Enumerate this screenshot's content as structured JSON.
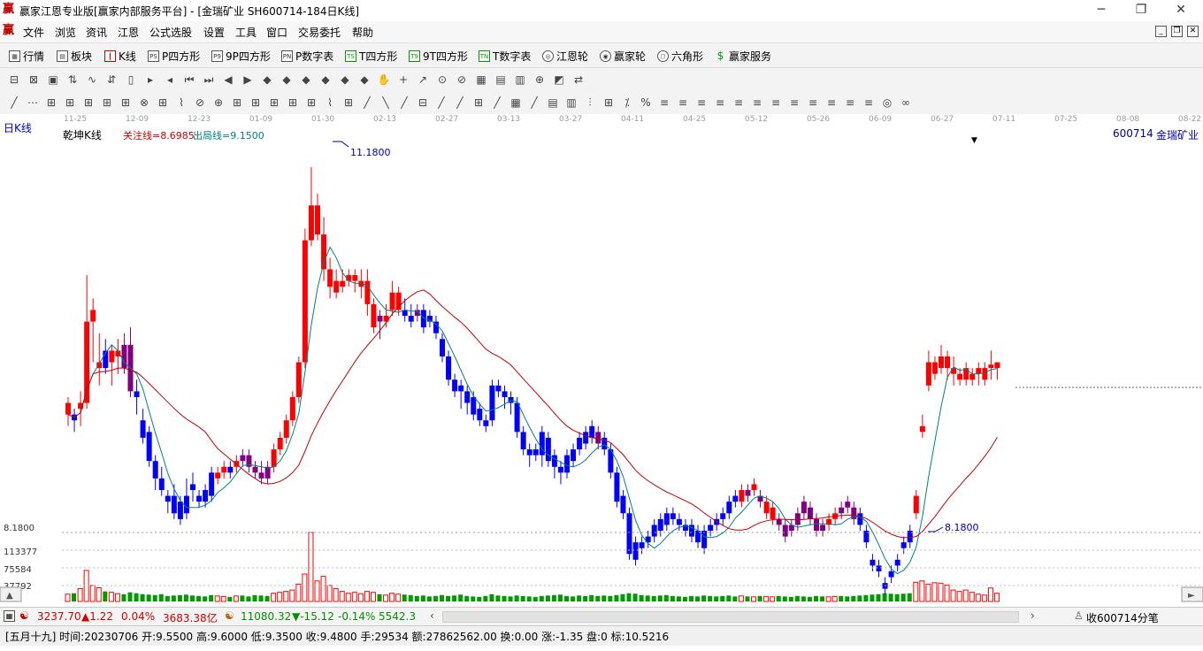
{
  "window": {
    "title": "赢家江恩专业版[赢家内部服务平台] - [金瑞矿业  SH600714-184日K线]",
    "app_icon": "赢",
    "controls": [
      "minimize-icon",
      "restore-icon",
      "close-icon"
    ]
  },
  "menu": {
    "items": [
      "文件",
      "浏览",
      "资讯",
      "江恩",
      "公式选股",
      "设置",
      "工具",
      "窗口",
      "交易委托",
      "帮助"
    ]
  },
  "toolbar": {
    "items": [
      {
        "icon": "grid-icon",
        "label": "行情"
      },
      {
        "icon": "blocks-icon",
        "label": "板块"
      },
      {
        "icon": "candles-icon",
        "label": "K线"
      },
      {
        "icon": "ps-icon",
        "label": "P四方形"
      },
      {
        "icon": "p9-icon",
        "label": "9P四方形"
      },
      {
        "icon": "pn-icon",
        "label": "P数字表"
      },
      {
        "icon": "ts-icon",
        "label": "T四方形"
      },
      {
        "icon": "t9-icon",
        "label": "9T四方形"
      },
      {
        "icon": "tn-icon",
        "label": "T数字表"
      },
      {
        "icon": "gann-wheel-icon",
        "label": "江恩轮"
      },
      {
        "icon": "winner-wheel-icon",
        "label": "赢家轮"
      },
      {
        "icon": "hexagon-icon",
        "label": "六角形"
      },
      {
        "icon": "dollar-icon",
        "label": "赢家服务"
      }
    ]
  },
  "chart_header": {
    "period_label": "日K线",
    "chart_name": "乾坤K线",
    "focus_line": "关注线=8.6985",
    "exit_line": "出局线=9.1500",
    "symbol": "600714",
    "stock_name": "金瑞矿业"
  },
  "date_axis": [
    "11-25",
    "12-09",
    "12-23",
    "01-09",
    "01-30",
    "02-13",
    "02-27",
    "03-13",
    "03-27",
    "04-11",
    "04-25",
    "05-12",
    "05-26",
    "06-09",
    "06-27",
    "07-11",
    "07-25",
    "08-08",
    "08-22"
  ],
  "price_axis": {
    "low_label": "8.1800"
  },
  "volume_axis": [
    "113377",
    "75584",
    "37792"
  ],
  "annotations": {
    "high": "11.1800",
    "low": "8.1800"
  },
  "colors": {
    "up": "#ff0000",
    "down": "#0000ff",
    "neutral": "#800080",
    "ma_short": "#008080",
    "ma_long": "#c00000",
    "volume_up": "#ff0000",
    "volume_down": "#009900"
  },
  "chart_data": {
    "type": "candlestick",
    "price_range": [
      8.05,
      11.4
    ],
    "volume_range": [
      0,
      151000
    ],
    "candles": [
      [
        9.15,
        9.05,
        9.2,
        8.95,
        "up",
        16000
      ],
      [
        9.05,
        9.0,
        9.1,
        8.9,
        "down",
        18000
      ],
      [
        9.1,
        9.15,
        9.25,
        8.95,
        "up",
        28000
      ],
      [
        9.15,
        9.85,
        10.25,
        9.1,
        "up",
        68000
      ],
      [
        9.85,
        9.95,
        10.05,
        9.5,
        "up",
        35000
      ],
      [
        9.45,
        9.5,
        9.75,
        9.3,
        "up",
        30000
      ],
      [
        9.6,
        9.45,
        9.7,
        9.4,
        "down",
        22000
      ],
      [
        9.6,
        9.5,
        9.65,
        9.3,
        "up",
        20000
      ],
      [
        9.55,
        9.6,
        9.7,
        9.4,
        "up",
        17000
      ],
      [
        9.65,
        9.45,
        9.75,
        9.4,
        "neutral",
        16000
      ],
      [
        9.65,
        9.25,
        9.8,
        9.2,
        "neutral",
        20000
      ],
      [
        9.25,
        9.2,
        9.35,
        9.05,
        "down",
        18000
      ],
      [
        9.0,
        8.85,
        9.1,
        8.8,
        "down",
        16000
      ],
      [
        8.9,
        8.65,
        8.95,
        8.6,
        "down",
        15000
      ],
      [
        8.65,
        8.5,
        8.7,
        8.4,
        "down",
        14000
      ],
      [
        8.5,
        8.4,
        8.6,
        8.35,
        "down",
        16000
      ],
      [
        8.35,
        8.3,
        8.4,
        8.2,
        "down",
        12000
      ],
      [
        8.35,
        8.2,
        8.45,
        8.15,
        "down",
        13000
      ],
      [
        8.3,
        8.15,
        8.35,
        8.1,
        "down",
        14000
      ],
      [
        8.35,
        8.2,
        8.5,
        8.15,
        "down",
        15000
      ],
      [
        8.45,
        8.4,
        8.55,
        8.3,
        "down",
        13000
      ],
      [
        8.35,
        8.3,
        8.4,
        8.25,
        "down",
        12000
      ],
      [
        8.4,
        8.3,
        8.45,
        8.25,
        "down",
        11000
      ],
      [
        8.55,
        8.35,
        8.6,
        8.3,
        "down",
        14000
      ],
      [
        8.5,
        8.55,
        8.6,
        8.45,
        "up",
        12000
      ],
      [
        8.55,
        8.6,
        8.65,
        8.5,
        "up",
        11000
      ],
      [
        8.6,
        8.55,
        8.65,
        8.5,
        "down",
        10000
      ],
      [
        8.6,
        8.65,
        8.7,
        8.55,
        "up",
        12000
      ],
      [
        8.65,
        8.7,
        8.75,
        8.6,
        "neutral",
        13000
      ],
      [
        8.7,
        8.6,
        8.75,
        8.55,
        "neutral",
        11000
      ],
      [
        8.6,
        8.55,
        8.65,
        8.5,
        "neutral",
        14000
      ],
      [
        8.55,
        8.5,
        8.65,
        8.45,
        "neutral",
        13000
      ],
      [
        8.5,
        8.6,
        8.65,
        8.45,
        "neutral",
        12000
      ],
      [
        8.6,
        8.75,
        8.8,
        8.55,
        "up",
        18000
      ],
      [
        8.75,
        8.85,
        8.9,
        8.7,
        "up",
        20000
      ],
      [
        8.85,
        9.0,
        9.05,
        8.8,
        "up",
        22000
      ],
      [
        9.0,
        9.2,
        9.25,
        8.95,
        "up",
        25000
      ],
      [
        9.2,
        9.5,
        9.55,
        9.15,
        "up",
        38000
      ],
      [
        9.5,
        10.55,
        10.65,
        9.45,
        "up",
        60000
      ],
      [
        10.55,
        10.85,
        11.18,
        10.5,
        "up",
        151000
      ],
      [
        10.85,
        10.6,
        10.95,
        10.55,
        "up",
        45000
      ],
      [
        10.6,
        10.3,
        10.75,
        10.2,
        "up",
        55000
      ],
      [
        10.3,
        10.15,
        10.4,
        10.05,
        "up",
        35000
      ],
      [
        10.2,
        10.1,
        10.3,
        10.05,
        "up",
        28000
      ],
      [
        10.15,
        10.2,
        10.3,
        10.1,
        "up",
        22000
      ],
      [
        10.2,
        10.25,
        10.3,
        10.15,
        "up",
        18000
      ],
      [
        10.25,
        10.2,
        10.3,
        10.1,
        "up",
        20000
      ],
      [
        10.2,
        10.15,
        10.3,
        10.05,
        "up",
        17000
      ],
      [
        10.2,
        10.0,
        10.3,
        9.9,
        "up",
        22000
      ],
      [
        10.0,
        9.8,
        10.05,
        9.75,
        "up",
        20000
      ],
      [
        9.85,
        9.9,
        9.95,
        9.7,
        "neutral",
        16000
      ],
      [
        9.85,
        9.9,
        10.0,
        9.8,
        "up",
        14000
      ],
      [
        9.95,
        10.1,
        10.2,
        9.9,
        "up",
        18000
      ],
      [
        10.1,
        9.95,
        10.15,
        9.9,
        "up",
        16000
      ],
      [
        9.95,
        9.9,
        10.05,
        9.85,
        "down",
        15000
      ],
      [
        9.9,
        9.85,
        10.0,
        9.8,
        "down",
        14000
      ],
      [
        9.95,
        9.9,
        10.0,
        9.85,
        "neutral",
        12000
      ],
      [
        9.95,
        9.8,
        10.0,
        9.75,
        "down",
        13000
      ],
      [
        9.9,
        9.85,
        9.95,
        9.8,
        "down",
        11000
      ],
      [
        9.85,
        9.75,
        9.9,
        9.7,
        "down",
        12000
      ],
      [
        9.7,
        9.55,
        9.75,
        9.5,
        "down",
        14000
      ],
      [
        9.55,
        9.35,
        9.6,
        9.3,
        "down",
        12000
      ],
      [
        9.35,
        9.25,
        9.4,
        9.2,
        "down",
        13000
      ],
      [
        9.3,
        9.25,
        9.35,
        9.1,
        "down",
        15000
      ],
      [
        9.25,
        9.15,
        9.3,
        9.05,
        "down",
        12000
      ],
      [
        9.2,
        9.05,
        9.25,
        9.0,
        "down",
        11000
      ],
      [
        9.1,
        9.0,
        9.15,
        8.95,
        "down",
        10000
      ],
      [
        9.0,
        8.95,
        9.05,
        8.9,
        "down",
        12000
      ],
      [
        9.0,
        9.3,
        9.35,
        8.95,
        "down",
        16000
      ],
      [
        9.3,
        9.25,
        9.35,
        9.2,
        "down",
        13000
      ],
      [
        9.25,
        9.2,
        9.3,
        9.1,
        "down",
        12000
      ],
      [
        9.2,
        9.15,
        9.25,
        9.05,
        "down",
        11000
      ],
      [
        9.15,
        8.9,
        9.2,
        8.85,
        "down",
        13000
      ],
      [
        8.9,
        8.75,
        8.95,
        8.7,
        "down",
        12000
      ],
      [
        8.75,
        8.7,
        8.8,
        8.6,
        "down",
        11000
      ],
      [
        8.75,
        8.7,
        8.8,
        8.65,
        "down",
        10000
      ],
      [
        8.9,
        8.7,
        8.95,
        8.6,
        "down",
        12000
      ],
      [
        8.85,
        8.65,
        8.9,
        8.6,
        "down",
        13000
      ],
      [
        8.7,
        8.6,
        8.75,
        8.5,
        "down",
        14000
      ],
      [
        8.6,
        8.55,
        8.65,
        8.45,
        "down",
        15000
      ],
      [
        8.7,
        8.55,
        8.75,
        8.5,
        "down",
        12000
      ],
      [
        8.75,
        8.65,
        8.8,
        8.6,
        "down",
        11000
      ],
      [
        8.85,
        8.75,
        8.9,
        8.7,
        "down",
        13000
      ],
      [
        8.9,
        8.8,
        8.95,
        8.75,
        "down",
        12000
      ],
      [
        8.95,
        8.85,
        9.0,
        8.8,
        "down",
        14000
      ],
      [
        8.9,
        8.8,
        8.95,
        8.75,
        "neutral",
        12000
      ],
      [
        8.85,
        8.75,
        8.9,
        8.7,
        "down",
        13000
      ],
      [
        8.75,
        8.55,
        8.8,
        8.5,
        "down",
        12000
      ],
      [
        8.55,
        8.3,
        8.6,
        8.25,
        "down",
        14000
      ],
      [
        8.35,
        8.2,
        8.4,
        8.15,
        "down",
        16000
      ],
      [
        8.2,
        7.85,
        8.25,
        7.8,
        "down",
        18000
      ],
      [
        7.95,
        7.8,
        8.0,
        7.75,
        "down",
        17000
      ],
      [
        7.95,
        7.9,
        8.0,
        7.85,
        "down",
        14000
      ],
      [
        8.0,
        7.95,
        8.05,
        7.9,
        "down",
        13000
      ],
      [
        8.1,
        8.0,
        8.15,
        7.95,
        "down",
        12000
      ],
      [
        8.15,
        8.05,
        8.2,
        8.0,
        "down",
        13000
      ],
      [
        8.2,
        8.1,
        8.25,
        8.05,
        "down",
        14000
      ],
      [
        8.2,
        8.15,
        8.25,
        8.1,
        "down",
        12000
      ],
      [
        8.15,
        8.1,
        8.2,
        8.05,
        "down",
        11000
      ],
      [
        8.1,
        8.05,
        8.15,
        8.0,
        "down",
        10000
      ],
      [
        8.1,
        8.0,
        8.15,
        7.95,
        "down",
        12000
      ],
      [
        8.05,
        7.95,
        8.1,
        7.9,
        "down",
        11000
      ],
      [
        8.05,
        7.9,
        8.1,
        7.85,
        "down",
        13000
      ],
      [
        8.1,
        8.05,
        8.15,
        8.0,
        "down",
        12000
      ],
      [
        8.15,
        8.1,
        8.2,
        8.05,
        "down",
        11000
      ],
      [
        8.2,
        8.15,
        8.25,
        8.1,
        "down",
        12000
      ],
      [
        8.3,
        8.2,
        8.35,
        8.15,
        "down",
        13000
      ],
      [
        8.35,
        8.3,
        8.4,
        8.25,
        "down",
        11000
      ],
      [
        8.4,
        8.3,
        8.45,
        8.25,
        "up",
        12000
      ],
      [
        8.35,
        8.4,
        8.45,
        8.3,
        "neutral",
        11000
      ],
      [
        8.4,
        8.45,
        8.5,
        8.35,
        "up",
        10000
      ],
      [
        8.35,
        8.3,
        8.4,
        8.25,
        "neutral",
        12000
      ],
      [
        8.3,
        8.2,
        8.35,
        8.15,
        "up",
        11000
      ],
      [
        8.25,
        8.15,
        8.3,
        8.1,
        "up",
        10000
      ],
      [
        8.15,
        8.1,
        8.2,
        8.05,
        "neutral",
        12000
      ],
      [
        8.1,
        8.0,
        8.15,
        7.95,
        "neutral",
        11000
      ],
      [
        8.1,
        8.05,
        8.15,
        8.0,
        "neutral",
        10000
      ],
      [
        8.2,
        8.1,
        8.25,
        8.05,
        "neutral",
        12000
      ],
      [
        8.3,
        8.2,
        8.35,
        8.15,
        "neutral",
        11000
      ],
      [
        8.25,
        8.15,
        8.3,
        8.1,
        "neutral",
        10000
      ],
      [
        8.15,
        8.05,
        8.2,
        8.0,
        "neutral",
        12000
      ],
      [
        8.1,
        8.05,
        8.15,
        8.0,
        "neutral",
        11000
      ],
      [
        8.15,
        8.1,
        8.2,
        8.05,
        "up",
        10000
      ],
      [
        8.2,
        8.15,
        8.25,
        8.1,
        "up",
        11000
      ],
      [
        8.25,
        8.2,
        8.3,
        8.15,
        "neutral",
        12000
      ],
      [
        8.3,
        8.25,
        8.35,
        8.2,
        "neutral",
        11000
      ],
      [
        8.25,
        8.15,
        8.3,
        8.1,
        "neutral",
        12000
      ],
      [
        8.2,
        8.1,
        8.25,
        8.05,
        "down",
        13000
      ],
      [
        8.05,
        7.95,
        8.1,
        7.9,
        "down",
        14000
      ],
      [
        7.8,
        7.75,
        7.85,
        7.7,
        "down",
        15000
      ],
      [
        7.75,
        7.7,
        7.8,
        7.65,
        "down",
        16000
      ],
      [
        7.6,
        7.55,
        7.65,
        7.5,
        "down",
        18000
      ],
      [
        7.7,
        7.65,
        7.75,
        7.6,
        "down",
        17000
      ],
      [
        7.8,
        7.75,
        7.85,
        7.7,
        "down",
        16000
      ],
      [
        7.95,
        7.9,
        8.0,
        7.85,
        "down",
        17000
      ],
      [
        7.95,
        8.05,
        8.1,
        7.9,
        "down",
        18000
      ],
      [
        8.35,
        8.2,
        8.4,
        8.15,
        "up",
        42000
      ],
      [
        8.9,
        8.95,
        9.05,
        8.85,
        "up",
        45000
      ],
      [
        9.3,
        9.5,
        9.6,
        9.25,
        "up",
        38000
      ],
      [
        9.5,
        9.4,
        9.55,
        9.35,
        "up",
        41000
      ],
      [
        9.45,
        9.55,
        9.65,
        9.4,
        "up",
        40000
      ],
      [
        9.55,
        9.45,
        9.6,
        9.35,
        "up",
        36000
      ],
      [
        9.45,
        9.4,
        9.55,
        9.3,
        "up",
        25000
      ],
      [
        9.4,
        9.35,
        9.45,
        9.3,
        "up",
        22000
      ],
      [
        9.35,
        9.45,
        9.5,
        9.3,
        "up",
        25000
      ],
      [
        9.4,
        9.35,
        9.45,
        9.3,
        "up",
        20000
      ],
      [
        9.4,
        9.45,
        9.5,
        9.3,
        "up",
        16000
      ],
      [
        9.35,
        9.45,
        9.5,
        9.3,
        "up",
        14000
      ],
      [
        9.45,
        9.48,
        9.6,
        9.35,
        "up",
        29534
      ],
      [
        9.45,
        9.5,
        9.5,
        9.35,
        "up",
        18000
      ]
    ]
  },
  "status_bar": {
    "sh_index": "3237.70",
    "sh_change": "▲1.22",
    "sh_pct": "0.04%",
    "sh_amount": "3683.38亿",
    "sz_index": "11080.32",
    "sz_change": "▼-15.12",
    "sz_pct": "-0.14%",
    "sz_amount": "5542.38",
    "tick_label": "收600714分笔"
  },
  "info_bar": {
    "text": "[五月十九] 时间:20230706 开:9.5500 高:9.6000 低:9.3500 收:9.4800 手:29534 额:27862562.00 换:0.00 涨:-1.35 盘:0 标:10.5216"
  }
}
